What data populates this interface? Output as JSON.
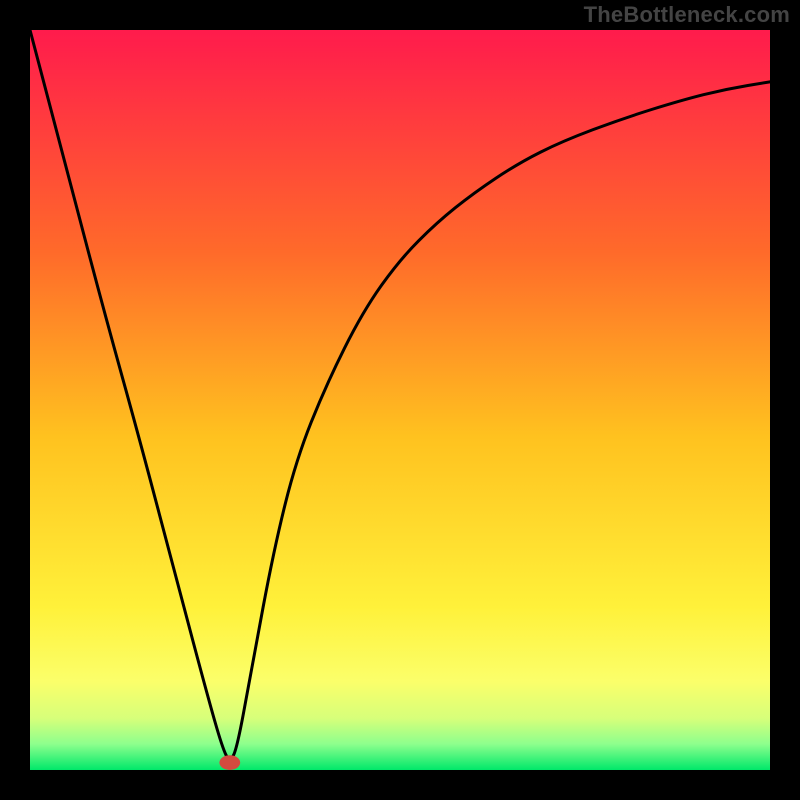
{
  "watermark": "TheBottleneck.com",
  "chart_data": {
    "type": "line",
    "title": "",
    "xlabel": "",
    "ylabel": "",
    "xlim": [
      0,
      100
    ],
    "ylim": [
      0,
      100
    ],
    "grid": false,
    "legend": false,
    "background_gradient": {
      "stops": [
        {
          "offset": 0.0,
          "color": "#ff1b4c"
        },
        {
          "offset": 0.3,
          "color": "#ff6a2a"
        },
        {
          "offset": 0.55,
          "color": "#ffc21f"
        },
        {
          "offset": 0.78,
          "color": "#fff13a"
        },
        {
          "offset": 0.88,
          "color": "#fbff6a"
        },
        {
          "offset": 0.93,
          "color": "#d7ff7a"
        },
        {
          "offset": 0.965,
          "color": "#8dff8d"
        },
        {
          "offset": 1.0,
          "color": "#00e86a"
        }
      ]
    },
    "curve": {
      "description": "Absolute-deviation style bottleneck curve with a single minimum",
      "x": [
        0,
        5,
        10,
        15,
        20,
        24,
        26,
        27,
        28,
        30,
        33,
        36,
        40,
        45,
        50,
        55,
        60,
        66,
        72,
        80,
        88,
        94,
        100
      ],
      "y": [
        100,
        81,
        62,
        44,
        25,
        10,
        3,
        1,
        3,
        14,
        30,
        42,
        52,
        62,
        69,
        74,
        78,
        82,
        85,
        88,
        90.5,
        92,
        93
      ],
      "min_x": 27,
      "min_y": 1
    },
    "marker": {
      "x": 27,
      "y": 1,
      "rx": 1.4,
      "ry": 1.0,
      "color": "#d44a3f"
    }
  }
}
